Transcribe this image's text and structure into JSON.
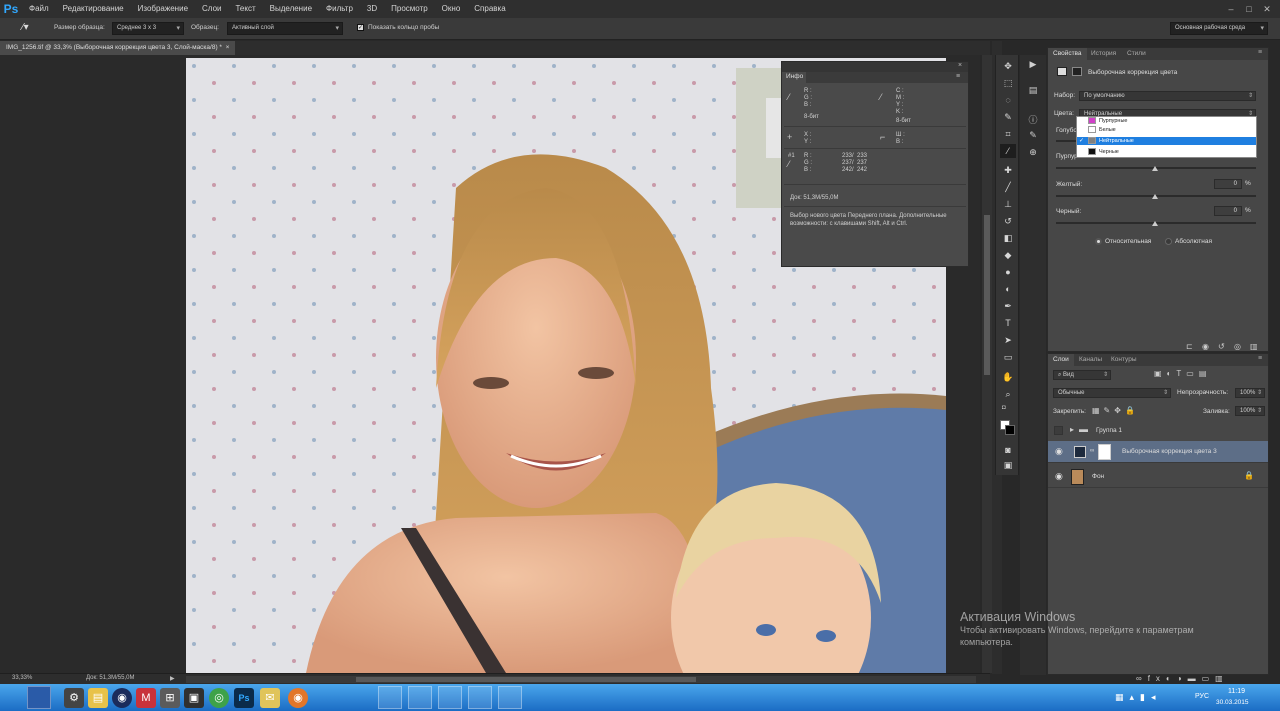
{
  "app": {
    "logo": "Ps"
  },
  "menu": [
    "Файл",
    "Редактирование",
    "Изображение",
    "Слои",
    "Текст",
    "Выделение",
    "Фильтр",
    "3D",
    "Просмотр",
    "Окно",
    "Справка"
  ],
  "options": {
    "sample_size_label": "Размер образца:",
    "sample_size_value": "Среднее 3 х 3",
    "sample_label": "Образец:",
    "sample_value": "Активный слой",
    "show_ring_label": "Показать кольцо пробы",
    "workspace_value": "Основная рабочая среда"
  },
  "document": {
    "tab_title": "IMG_1256.tif @ 33,3% (Выборочная коррекция цвета 3, Слой-маска/8) *",
    "zoom": "33,33%",
    "doc_size": "Док: 51,3M/55,0M"
  },
  "info_panel": {
    "title": "Инфо",
    "rgb_labels": "R :\nG :\nB :",
    "cmyk_labels": "C :\nM :\nY :\nK :",
    "bit1": "8-бит",
    "bit2": "8-бит",
    "xy_labels": "X :\nY :",
    "wh_labels": "Ш :\nВ :",
    "sample_label": "#1",
    "sample_channels": "R :\nG :\nB :",
    "sample_values": "233/  233\n237/  237\n242/  242",
    "doc_size": "Док: 51,3M/55,0M",
    "hint": "Выбор нового цвета Переднего плана. Дополнительные возможности: с клавишами Shift, Alt и Ctrl."
  },
  "properties": {
    "tabs": [
      "Свойства",
      "История",
      "Стили"
    ],
    "title": "Выборочная коррекция цвета",
    "preset_label": "Набор:",
    "preset_value": "По умолчанию",
    "colors_label": "Цвета:",
    "colors_value": "Нейтральные",
    "cyan_label": "Голубой:",
    "magenta_label": "Пурпурный:",
    "yellow_label": "Желтый:",
    "yellow_value": "0",
    "black_label": "Черный:",
    "black_value": "0",
    "pct": "%",
    "relative_label": "Относительная",
    "absolute_label": "Абсолютная",
    "dropdown_items": [
      {
        "label": "Пурпурные",
        "swatch": "#d040c8"
      },
      {
        "label": "Белые",
        "swatch": "#ffffff"
      },
      {
        "label": "Нейтральные",
        "swatch": "#808080"
      },
      {
        "label": "Черные",
        "swatch": "#111111"
      }
    ]
  },
  "layers_panel": {
    "tabs": [
      "Слои",
      "Каналы",
      "Контуры"
    ],
    "filter_value": "Вид",
    "blend_value": "Обычные",
    "opacity_label": "Непрозрачность:",
    "opacity_value": "100%",
    "lock_label": "Закрепить:",
    "fill_label": "Заливка:",
    "fill_value": "100%",
    "layers": [
      {
        "name": "Группа 1"
      },
      {
        "name": "Выборочная коррекция цвета 3"
      },
      {
        "name": "Фон"
      }
    ]
  },
  "watermark": {
    "title": "Активация Windows",
    "line1": "Чтобы активировать Windows, перейдите к параметрам",
    "line2": "компьютера."
  },
  "taskbar": {
    "lang": "РУС",
    "time": "11:19",
    "date": "30.03.2015"
  },
  "colors": {
    "selection": "#1f7fe0",
    "layer_selected": "#5d6e87",
    "ps_blue": "#31a8ff"
  }
}
